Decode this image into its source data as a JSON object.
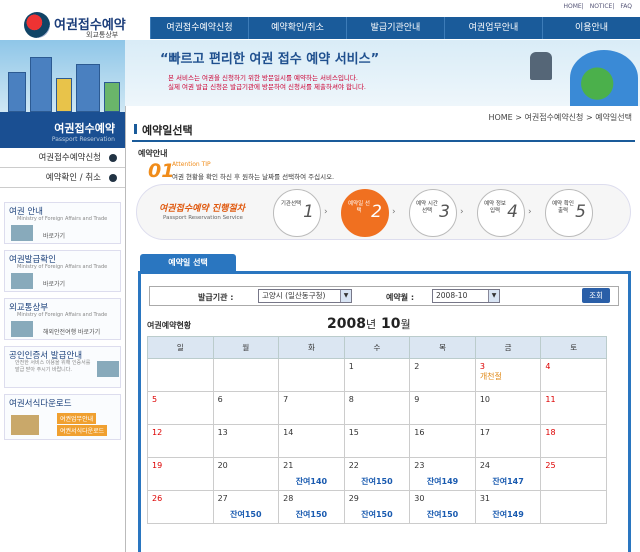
{
  "header": {
    "logo_title": "여권접수예약",
    "logo_sub": "외교통상부",
    "util_links": [
      "HOME",
      "NOTICE",
      "FAQ"
    ],
    "gnb": [
      "여권접수예약신청",
      "예약확인/취소",
      "발급기관안내",
      "여권업무안내",
      "이용안내"
    ]
  },
  "visual": {
    "slogan": "“빠르고 편리한 여권 접수 예약 서비스”",
    "sub1": "본 서비스는 여권을 신청하기 위한 방문일시를 예약하는 서비스입니다.",
    "sub2": "실제 여권 발급 신청은 발급기관에 방문하여 신청서를 제출하셔야 합니다."
  },
  "sidebar": {
    "title": "여권접수예약",
    "subtitle": "Passport Reservation",
    "menu": [
      "여권접수예약신청",
      "예약확인 / 취소"
    ],
    "boxes": [
      {
        "title": "여권 안내",
        "sub": "Ministry of Foreign Affairs and Trade",
        "go": "바로가기"
      },
      {
        "title": "여권발급확인",
        "sub": "Ministry of Foreign Affairs and Trade",
        "go": "바로가기"
      },
      {
        "title": "외교통상부",
        "sub": "Ministry of Foreign Affairs and Trade",
        "go": "해외안전여행 바로가기"
      },
      {
        "title": "공인인증서 발급안내",
        "sub": "안전한 서비스 이용을 위해 인증서를 발급 받아 주시기 바랍니다.",
        "go": ""
      },
      {
        "title": "여권서식다운로드",
        "sub": "",
        "go": "",
        "btn1": "여권업무안내",
        "btn2": "여권서식다운로드"
      }
    ]
  },
  "main": {
    "breadcrumb": "HOME > 여권접수예약신청 > 예약일선택",
    "title": "예약일선택",
    "guide_title": "예약안내",
    "guide_num": "01",
    "guide_tip": "Attention TIP",
    "guide_text": "여권 현황을 확인 하신 후 원하는 날짜를 선택하여 주십시오.",
    "steps_title": "여권접수예약 진행절차",
    "steps_sub": "Passport Reservation Service",
    "steps": [
      {
        "label": "기관선택",
        "num": "1"
      },
      {
        "label": "예약일 선택",
        "num": "2"
      },
      {
        "label": "예약 시간선택",
        "num": "3"
      },
      {
        "label": "예약 정보입력",
        "num": "4"
      },
      {
        "label": "예약 확인출력",
        "num": "5"
      }
    ],
    "tab": "예약일 선택",
    "filter": {
      "agency_label": "발급기관 :",
      "agency_value": "고양시 (일산동구청)",
      "month_label": "예약월 :",
      "month_value": "2008-10",
      "search_btn": "조회"
    },
    "calendar_title": "여권예약현황",
    "month_year": "2008",
    "month_year_suffix": "년",
    "month_num": "10",
    "month_num_suffix": "월",
    "weekdays": [
      "일",
      "월",
      "화",
      "수",
      "목",
      "금",
      "토"
    ],
    "weeks": [
      [
        {
          "d": ""
        },
        {
          "d": ""
        },
        {
          "d": ""
        },
        {
          "d": "1"
        },
        {
          "d": "2"
        },
        {
          "d": "3",
          "h": "개천절"
        },
        {
          "d": "4"
        }
      ],
      [
        {
          "d": "5"
        },
        {
          "d": "6"
        },
        {
          "d": "7"
        },
        {
          "d": "8"
        },
        {
          "d": "9"
        },
        {
          "d": "10"
        },
        {
          "d": "11"
        }
      ],
      [
        {
          "d": "12"
        },
        {
          "d": "13"
        },
        {
          "d": "14"
        },
        {
          "d": "15"
        },
        {
          "d": "16"
        },
        {
          "d": "17"
        },
        {
          "d": "18"
        }
      ],
      [
        {
          "d": "19"
        },
        {
          "d": "20"
        },
        {
          "d": "21",
          "x": "잔여140"
        },
        {
          "d": "22",
          "x": "잔여150"
        },
        {
          "d": "23",
          "x": "잔여149"
        },
        {
          "d": "24",
          "x": "잔여147"
        },
        {
          "d": "25"
        }
      ],
      [
        {
          "d": "26"
        },
        {
          "d": "27",
          "x": "잔여150"
        },
        {
          "d": "28",
          "x": "잔여150"
        },
        {
          "d": "29",
          "x": "잔여150"
        },
        {
          "d": "30",
          "x": "잔여150"
        },
        {
          "d": "31",
          "x": "잔여149"
        },
        {
          "d": ""
        }
      ]
    ]
  }
}
